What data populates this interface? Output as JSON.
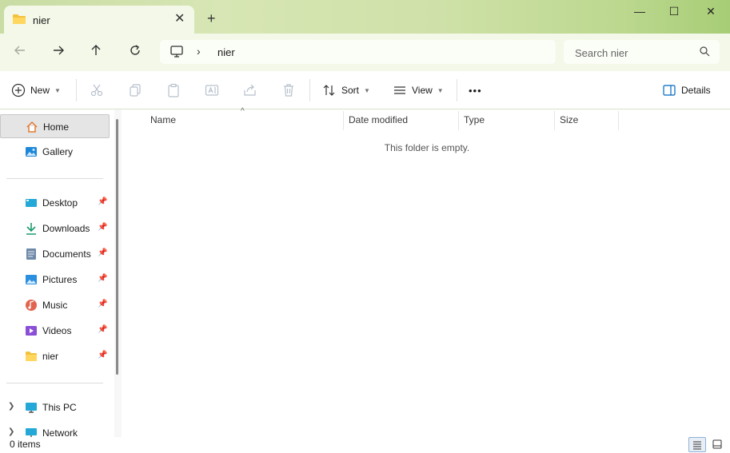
{
  "tab": {
    "title": "nier",
    "close": "✕",
    "new_tab": "+"
  },
  "window": {
    "minimize": "—",
    "maximize": "☐",
    "close": "✕"
  },
  "address": {
    "separator": "›",
    "path": [
      "nier"
    ]
  },
  "search": {
    "placeholder": "Search nier"
  },
  "toolbar": {
    "new_label": "New",
    "sort_label": "Sort",
    "view_label": "View",
    "more_label": "•••",
    "details_label": "Details"
  },
  "sidebar": {
    "items": [
      {
        "label": "Home",
        "icon": "home-icon",
        "selected": true
      },
      {
        "label": "Gallery",
        "icon": "gallery-icon"
      },
      {
        "label": "Desktop",
        "icon": "desktop-icon",
        "pinned": true
      },
      {
        "label": "Downloads",
        "icon": "downloads-icon",
        "pinned": true
      },
      {
        "label": "Documents",
        "icon": "documents-icon",
        "pinned": true
      },
      {
        "label": "Pictures",
        "icon": "pictures-icon",
        "pinned": true
      },
      {
        "label": "Music",
        "icon": "music-icon",
        "pinned": true
      },
      {
        "label": "Videos",
        "icon": "videos-icon",
        "pinned": true
      },
      {
        "label": "nier",
        "icon": "folder-icon",
        "pinned": true
      },
      {
        "label": "This PC",
        "icon": "this-pc-icon"
      },
      {
        "label": "Network",
        "icon": "network-icon"
      }
    ]
  },
  "columns": [
    "Name",
    "Date modified",
    "Type",
    "Size"
  ],
  "empty_message": "This folder is empty.",
  "status": {
    "item_count": "0 items"
  },
  "colors": {
    "titlebar_gradient_start": "#c9dca4",
    "titlebar_gradient_end": "#a7cd76",
    "tab_background": "#f3f8e8",
    "folder_yellow": "#f4c13d",
    "selected_item": "#e5e5e5",
    "accent": "#0067c0"
  }
}
